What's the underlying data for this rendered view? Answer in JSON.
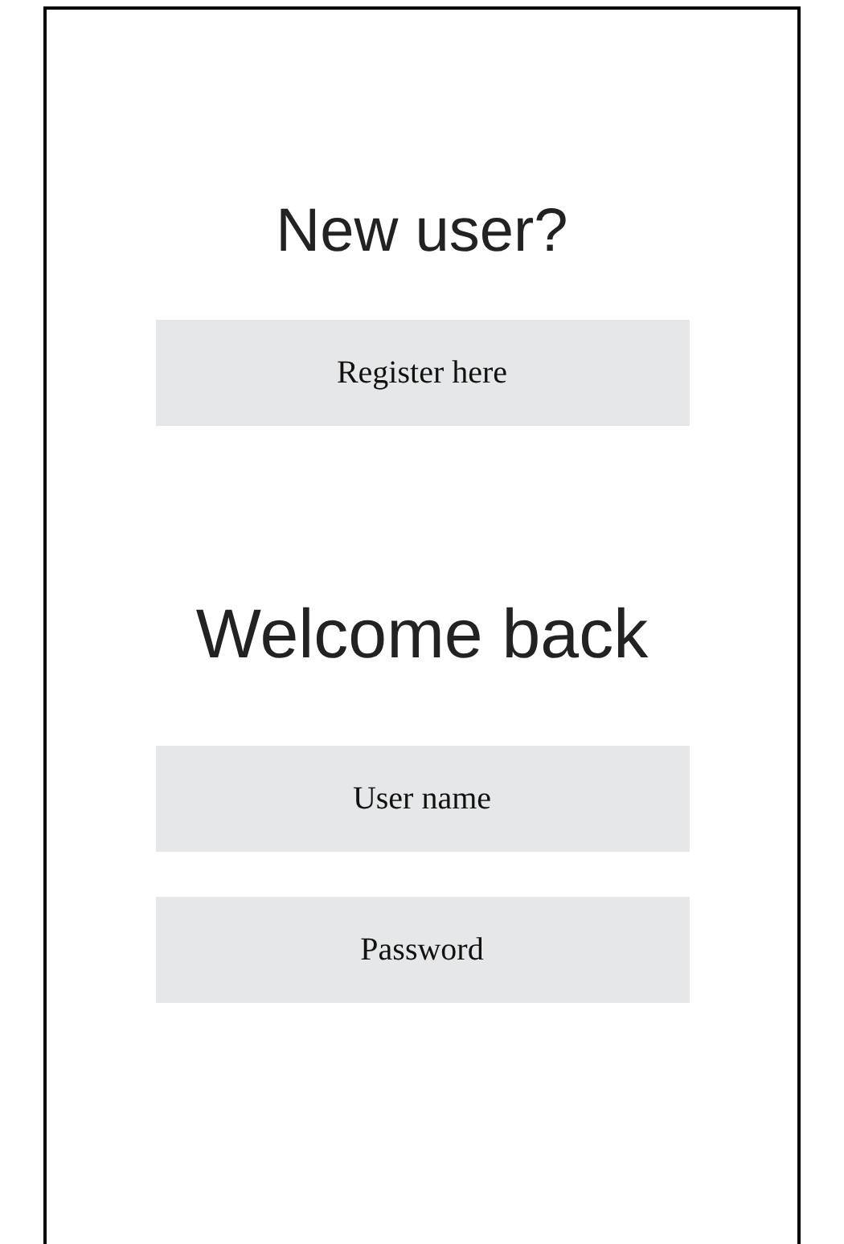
{
  "register_section": {
    "heading": "New user?",
    "button": "Register here"
  },
  "login_section": {
    "heading": "Welcome back",
    "fields": [
      {
        "placeholder": "User name"
      },
      {
        "placeholder": "Password"
      }
    ]
  }
}
